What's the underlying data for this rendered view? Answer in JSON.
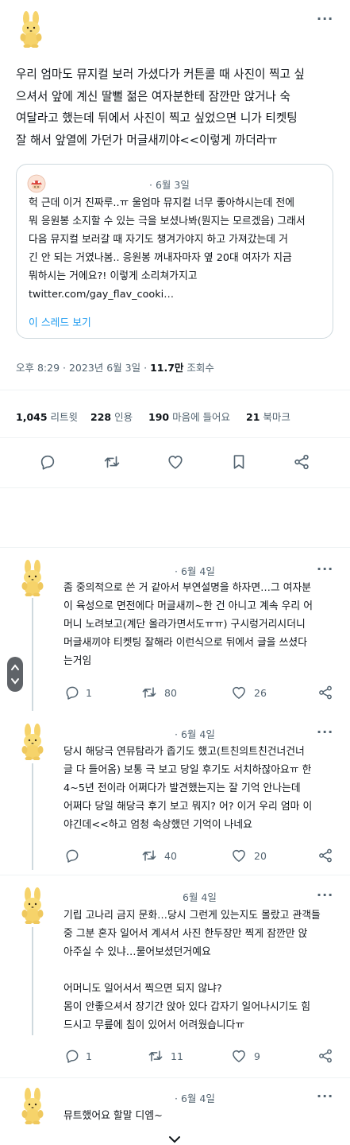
{
  "main_tweet": {
    "text": "우리 엄마도 뮤지컬 보러 가셨다가 커튼콜 때 사진이 찍고 싶\n으셔서 앞에 계신 딸뻘 젊은 여자분한테 잠깐만 앉거나 숙\n여달라고 했는데 뒤에서 사진이 찍고 싶었으면 니가 티켓팅\n잘 해서 앞열에 가던가 머글새끼야<<이렇게 까더라ㅠ",
    "quote": {
      "date": "· 6월 3일",
      "text": "헉 근데 이거 진짜루..ㅠ 울엄마 뮤지컬 너무 좋아하시는데 전에\n뭐 응원봉 소지할 수 있는 극을 보셨나봐(뭔지는 모르겠음) 그래서\n다음 뮤지컬 보러갈 때 자기도 챙겨가야지 하고 가져갔는데 거\n긴 안 되는 거였나봄.. 응원봉 꺼내자마자 옆 20대 여자가 지금\n뭐하시는 거에요?! 이렇게 소리쳐가지고\ntwitter.com/gay_flav_cooki…",
      "show_thread": "이 스레드 보기"
    },
    "time": "오후 8:29 · 2023년 6월 3일 · ",
    "views_count": "11.7만",
    "views_label": " 조회수",
    "stats": {
      "retweets_count": "1,045",
      "retweets_label": " 리트윗",
      "quotes_count": "228",
      "quotes_label": " 인용",
      "likes_count": "190",
      "likes_label": " 마음에 들어요",
      "bookmarks_count": "21",
      "bookmarks_label": " 북마크"
    }
  },
  "replies": [
    {
      "date": "· 6월 4일",
      "text": "좀 중의적으로 쓴 거 같아서 부연설명을 하자면…그 여자분\n이 육성으로 면전에다 머글새끼~한 건 아니고 계속 우리 어\n머니 노려보고(계단 올라가면서도ㅠㅠ) 구시렁거리시더니\n머글새끼야 티켓팅 잘해라 이런식으로 뒤에서 글을 쓰셨다\n는거임",
      "replies": "1",
      "retweets": "80",
      "likes": "26"
    },
    {
      "date": "· 6월 4일",
      "text": "당시 해당극 연뮤탐라가 좁기도 했고(트친의트친건너건너\n글 다 들어옴) 보통 극 보고 당일 후기도 서치하잖아요ㅠ 한\n4~5년 전이라 어쩌다가 발견했는지는 잘 기억 안나는데\n어쩌다 당일 해당극 후기 보고 뭐지? 어? 이거 우리 엄마 이\n야긴데<<하고 엄청 속상했던 기억이 나네요",
      "replies": "",
      "retweets": "40",
      "likes": "20"
    },
    {
      "date": "6월 4일",
      "text": "기립 고나리 금지 문화…당시 그런게 있는지도 몰랐고 관객들\n중 그분 혼자 일어서 계셔서 사진 한두장만 찍게 잠깐만 앉\n아주실 수 있냐…물어보셨던거예요\n\n어머니도 일어서서 찍으면 되지 않냐?\n몸이 안좋으셔서 장기간 앉아 있다 갑자기 일어나시기도 힘\n드시고 무릎에 침이 있어서 어려웠습니다ㅠ",
      "replies": "1",
      "retweets": "11",
      "likes": "9"
    },
    {
      "date": "· 6월 4일",
      "text": "뮤트했어요 할말 디엠~"
    }
  ],
  "colors": {
    "accent": "#1d9bf0",
    "muted": "#536471",
    "border": "#cfd9de"
  },
  "icons": [
    "bunny-avatar",
    "more-icon",
    "reply-icon",
    "retweet-icon",
    "like-icon",
    "bookmark-icon",
    "share-icon",
    "chevron-down-icon"
  ]
}
